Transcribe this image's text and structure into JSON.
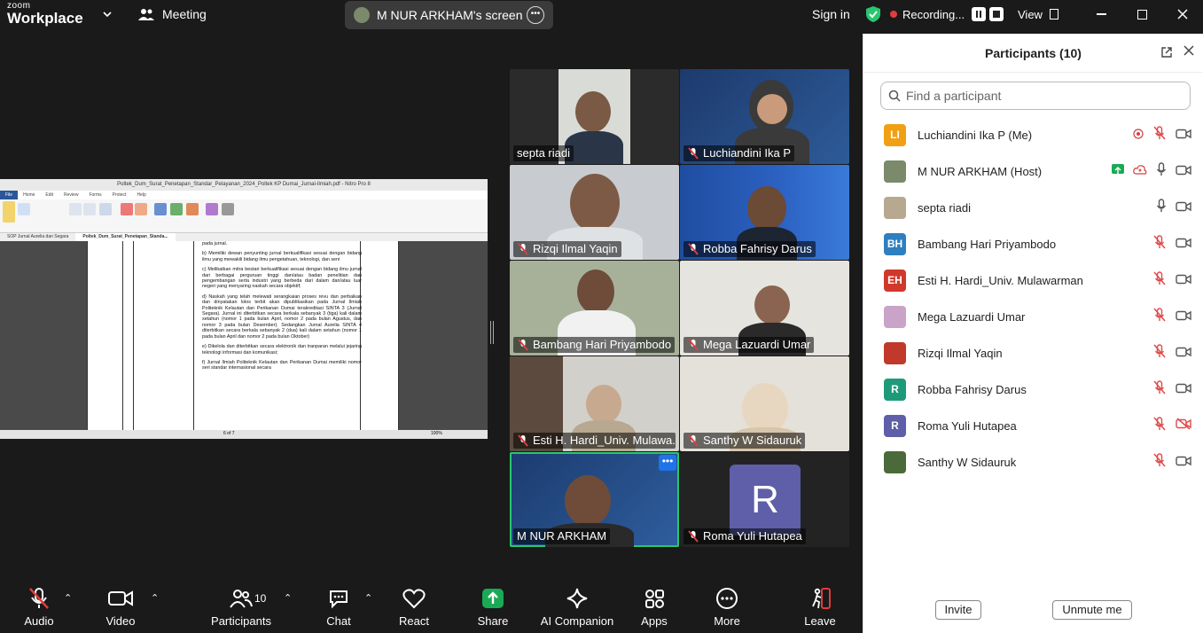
{
  "app": {
    "brand_line1": "zoom",
    "brand_line2": "Workplace",
    "meeting_label": "Meeting"
  },
  "shared": {
    "label": "M NUR ARKHAM's screen"
  },
  "topbar": {
    "signin": "Sign in",
    "recording": "Recording...",
    "view": "View"
  },
  "document": {
    "title": "Poltek_Dum_Surat_Penetapan_Standar_Pelayanan_2024_Poltek KP Dumai_Jurnal-Ilmiah.pdf - Nitro Pro 8",
    "ribbon_tabs": [
      "File",
      "Home",
      "Edit",
      "Review",
      "Forms",
      "Protect",
      "Help"
    ],
    "doc_tabs": [
      "SOP Jurnal Aurelia dan Segara",
      "Poltek_Dum_Surat_Penetapan_Standa..."
    ],
    "page_indicator": "6 of 7",
    "zoom": "100%",
    "paragraphs": [
      "pada jurnal.",
      "b)  Memiliki dewan penyunting jurnal berkualifikasi sesuai dengan bidang ilmu yang mewakili bidang ilmu pengetahuan, teknologi, dan seni",
      "c)  Melibatkan mitra bestari berkualifikasi sesuai dengan bidang ilmu jurnal dari berbagai perguruan tinggi dan/atau badan penelitian dan pengembangan serta industri yang berbeda dari dalam dan/atau luar negeri yang menyaring naskah secara objektif;",
      "d)  Naskah yang telah melewati serangkaian proses revu dan perbaikan dan dinyatakan lolos terbit akan dipublikasikan pada Jurnal Ilmiah Politeknik Kelautan dan Perikanan Dumai terakreditasi SINTA 3 (Jurnal Segara). Jurnal ini diterbitkan secara berkala sebanyak 3 (tiga) kali dalam setahun (nomor 1 pada bulan April, nomor 2 pada bulan Agustus, dan nomor 3 pada bulan Desember). Sedangkan Jurnal Aurelia SINTA 4 diterbitkan secara berkala sebanyak 2 (dua) kali dalam setahun (nomor 1 pada bulan April dan nomor 2 pada bulan Oktober)",
      "e)  Dikelola dan diterbitkan secara elektronik dan tranparan melalui jejaring teknologi informasi dan komunikasi;",
      "f)  Jurnal Ilmiah Politeknik Kelautan dan Perikanan Dumai memiliki nomor seri standar internasional secara"
    ]
  },
  "tiles": [
    {
      "name": "septa riadi",
      "muted": false
    },
    {
      "name": "Luchiandini Ika P",
      "muted": true
    },
    {
      "name": "Rizqi Ilmal Yaqin",
      "muted": true
    },
    {
      "name": "Robba Fahrisy Darus",
      "muted": true
    },
    {
      "name": "Bambang Hari Priyambodo",
      "muted": true
    },
    {
      "name": "Mega Lazuardi Umar",
      "muted": true
    },
    {
      "name": "Esti H. Hardi_Univ. Mulawa...",
      "muted": true
    },
    {
      "name": "Santhy W Sidauruk",
      "muted": true
    },
    {
      "name": "M NUR ARKHAM",
      "muted": false
    },
    {
      "name": "Roma Yuli Hutapea",
      "muted": true,
      "avatar_letter": "R"
    }
  ],
  "toolbar": {
    "audio": "Audio",
    "video": "Video",
    "participants": "Participants",
    "participants_count": "10",
    "chat": "Chat",
    "react": "React",
    "share": "Share",
    "ai": "AI Companion",
    "apps": "Apps",
    "more": "More",
    "leave": "Leave"
  },
  "panel": {
    "title": "Participants (10)",
    "search_placeholder": "Find a participant",
    "invite": "Invite",
    "unmute_me": "Unmute me",
    "participants": [
      {
        "initials": "LI",
        "name": "Luchiandini Ika P (Me)",
        "color": "#f0a012",
        "mic": "muted",
        "video": "on",
        "record": true
      },
      {
        "initials": "",
        "name": "M NUR ARKHAM (Host)",
        "color": "#7a8a6a",
        "mic": "on",
        "video": "on",
        "share": true
      },
      {
        "initials": "",
        "name": "septa riadi",
        "color": "#b7a98f",
        "mic": "on",
        "video": "on"
      },
      {
        "initials": "BH",
        "name": "Bambang Hari Priyambodo",
        "color": "#2e7fc0",
        "mic": "muted",
        "video": "on"
      },
      {
        "initials": "EH",
        "name": "Esti H. Hardi_Univ. Mulawarman",
        "color": "#d0382b",
        "mic": "muted",
        "video": "on"
      },
      {
        "initials": "",
        "name": "Mega Lazuardi Umar",
        "color": "#c9a3c8",
        "mic": "muted",
        "video": "on"
      },
      {
        "initials": "",
        "name": "Rizqi Ilmal Yaqin",
        "color": "#c0392b",
        "mic": "muted",
        "video": "on"
      },
      {
        "initials": "R",
        "name": "Robba Fahrisy Darus",
        "color": "#1e9a7a",
        "mic": "muted",
        "video": "on"
      },
      {
        "initials": "R",
        "name": "Roma Yuli Hutapea",
        "color": "#5e5fa8",
        "mic": "muted",
        "video": "off"
      },
      {
        "initials": "",
        "name": "Santhy W Sidauruk",
        "color": "#4a6a3a",
        "mic": "muted",
        "video": "on"
      }
    ]
  }
}
